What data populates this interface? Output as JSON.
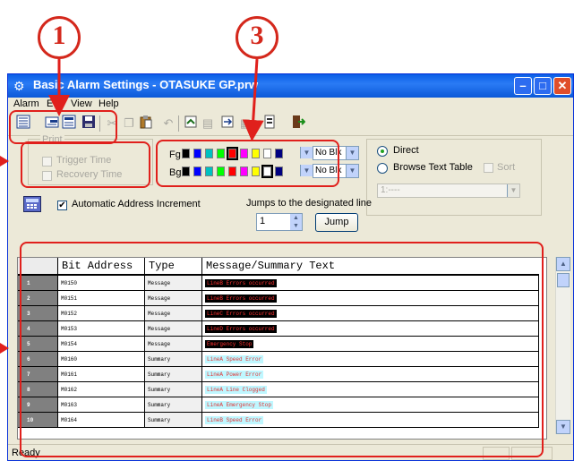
{
  "annotations": {
    "circle_1": "1",
    "circle_3": "3"
  },
  "window": {
    "title": "Basic Alarm Settings - OTASUKE GP.prw",
    "app_icon": "alarm-settings-app-icon",
    "controls": [
      "minimize-icon",
      "maximize-icon",
      "close-icon"
    ]
  },
  "menubar": {
    "items": [
      "Alarm",
      "Edit",
      "View",
      "Help"
    ]
  },
  "toolbar": {
    "icons": [
      "list-view-icon",
      "insert-row-icon",
      "detail-view-icon",
      "save-icon",
      "cut-icon",
      "copy-icon",
      "paste-icon",
      "undo-icon",
      "import-icon",
      "export-icon",
      "find-icon",
      "replace-icon",
      "properties-icon",
      "exit-icon"
    ]
  },
  "print": {
    "legend": "Print",
    "trigger_time": "Trigger Time",
    "recovery_time": "Recovery Time"
  },
  "colors": {
    "fg_label": "Fg",
    "bg_label": "Bg",
    "fg_blink": "No Blk",
    "bg_blink": "No Blk",
    "palette": [
      "#000000",
      "#0000ff",
      "#00c0c0",
      "#00ff00",
      "#ff0000",
      "#ff00ff",
      "#ffff00",
      "#ffffff",
      "#000080"
    ],
    "fg_selected": "#ff0000",
    "bg_selected": "#ffffff"
  },
  "text_source": {
    "direct": "Direct",
    "browse": "Browse Text Table",
    "sort": "Sort",
    "table_value": "1:----"
  },
  "address": {
    "auto_increment": "Automatic Address Increment",
    "auto_increment_checked": "✔",
    "keypad_icon": "address-keypad-icon"
  },
  "jump": {
    "label": "Jumps to the designated line",
    "value": "1",
    "button": "Jump"
  },
  "table": {
    "columns": [
      "",
      "Bit Address",
      "Type",
      "Message/Summary Text"
    ],
    "rows": [
      {
        "num": "1",
        "address": "M0150",
        "type": "Message",
        "text": "LineB Errors occurred",
        "fg": "#ff3030",
        "bg": "#000000"
      },
      {
        "num": "2",
        "address": "M0151",
        "type": "Message",
        "text": "LineB Errors occurred",
        "fg": "#ff3030",
        "bg": "#000000"
      },
      {
        "num": "3",
        "address": "M0152",
        "type": "Message",
        "text": "LineC Errors occurred",
        "fg": "#ff3030",
        "bg": "#000000"
      },
      {
        "num": "4",
        "address": "M0153",
        "type": "Message",
        "text": "LineD Errors occurred",
        "fg": "#ff3030",
        "bg": "#000000"
      },
      {
        "num": "5",
        "address": "M0154",
        "type": "Message",
        "text": "Emergency Stop",
        "fg": "#ff3030",
        "bg": "#000000"
      },
      {
        "num": "6",
        "address": "M0160",
        "type": "Summary",
        "text": "LineA Speed Error",
        "fg": "#e03030",
        "bg": "#bff7ff"
      },
      {
        "num": "7",
        "address": "M0161",
        "type": "Summary",
        "text": "LineA Power Error",
        "fg": "#e03030",
        "bg": "#bff7ff"
      },
      {
        "num": "8",
        "address": "M0162",
        "type": "Summary",
        "text": "LineA Line Clogged",
        "fg": "#e03030",
        "bg": "#bff7ff"
      },
      {
        "num": "9",
        "address": "M0163",
        "type": "Summary",
        "text": "LineA Emergency Stop",
        "fg": "#e03030",
        "bg": "#bff7ff"
      },
      {
        "num": "10",
        "address": "M0164",
        "type": "Summary",
        "text": "LineB Speed Error",
        "fg": "#e03030",
        "bg": "#bff7ff"
      }
    ]
  },
  "status": {
    "text": "Ready"
  },
  "accent": {
    "annotation_red": "#e0201c",
    "title_blue": "#0a5ee6"
  }
}
